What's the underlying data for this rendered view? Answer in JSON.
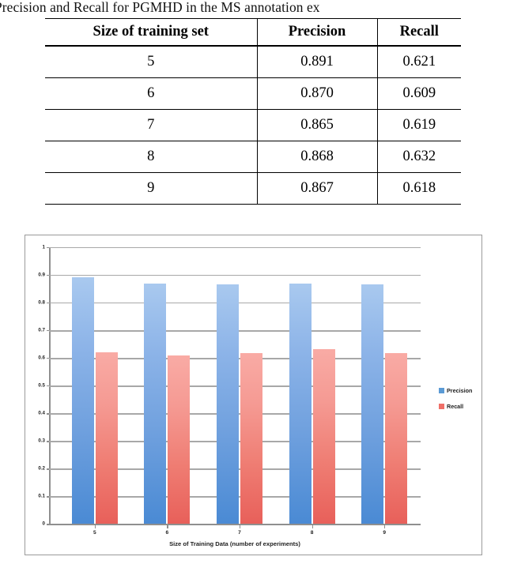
{
  "caption": {
    "text": "Precision and Recall for PGMHD in the MS annotation ex"
  },
  "table": {
    "headers": [
      "Size of training set",
      "Precision",
      "Recall"
    ],
    "rows": [
      [
        "5",
        "0.891",
        "0.621"
      ],
      [
        "6",
        "0.870",
        "0.609"
      ],
      [
        "7",
        "0.865",
        "0.619"
      ],
      [
        "8",
        "0.868",
        "0.632"
      ],
      [
        "9",
        "0.867",
        "0.618"
      ]
    ]
  },
  "chart_data": {
    "type": "bar",
    "title": "",
    "categories": [
      "5",
      "6",
      "7",
      "8",
      "9"
    ],
    "series": [
      {
        "name": "Precision",
        "values": [
          0.891,
          0.87,
          0.865,
          0.868,
          0.867
        ],
        "color": "#5b9bd5"
      },
      {
        "name": "Recall",
        "values": [
          0.621,
          0.609,
          0.619,
          0.632,
          0.618
        ],
        "color": "#ef6f68"
      }
    ],
    "xlabel": "Size of Training Data (number of experiments)",
    "ylabel": "",
    "ylim": [
      0,
      1
    ],
    "ytick_labels": [
      "1",
      "0.9",
      "0.8",
      "0.7",
      "0.6",
      "0.5",
      "0.4",
      "0.3",
      "0.2",
      "0.1",
      "0"
    ],
    "ytick_values": [
      1,
      0.9,
      0.8,
      0.7,
      0.6,
      0.5,
      0.4,
      0.3,
      0.2,
      0.1,
      0
    ],
    "grid": true,
    "legend_position": "right"
  }
}
